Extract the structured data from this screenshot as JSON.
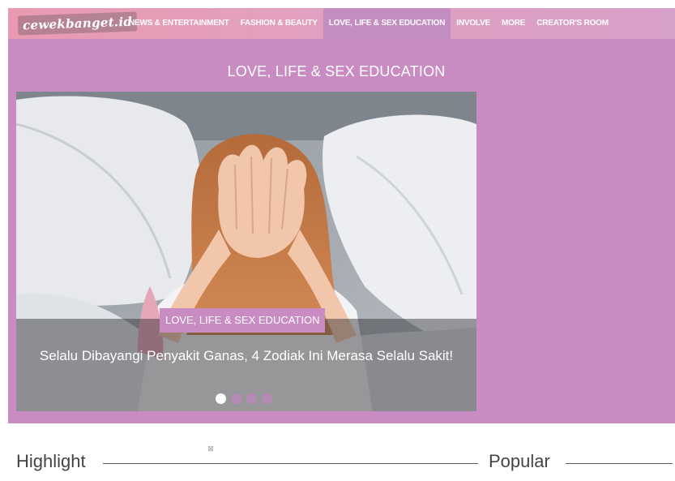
{
  "brand": {
    "logo_text": "cewekbanget.id"
  },
  "nav": {
    "items": [
      {
        "label": "NEWS & ENTERTAINMENT",
        "active": false
      },
      {
        "label": "FASHION & BEAUTY",
        "active": false
      },
      {
        "label": "LOVE, LIFE & SEX EDUCATION",
        "active": true
      },
      {
        "label": "INVOLVE",
        "active": false
      },
      {
        "label": "MORE",
        "active": false
      },
      {
        "label": "CREATOR'S ROOM",
        "active": false
      }
    ]
  },
  "section": {
    "title": "LOVE, LIFE & SEX EDUCATION"
  },
  "hero": {
    "category": "LOVE, LIFE & SEX EDUCATION",
    "headline": "Selalu Dibayangi Penyakit Ganas, 4 Zodiak Ini Merasa Selalu Sakit!",
    "slide_count": 4,
    "active_slide": 1
  },
  "lower": {
    "highlight_label": "Highlight",
    "popular_label": "Popular",
    "broken_image_icon": "broken-image-icon"
  },
  "colors": {
    "nav_gradient_start": "#e99ab0",
    "nav_active": "#c38dc2",
    "section_bg": "#c88cc2"
  }
}
